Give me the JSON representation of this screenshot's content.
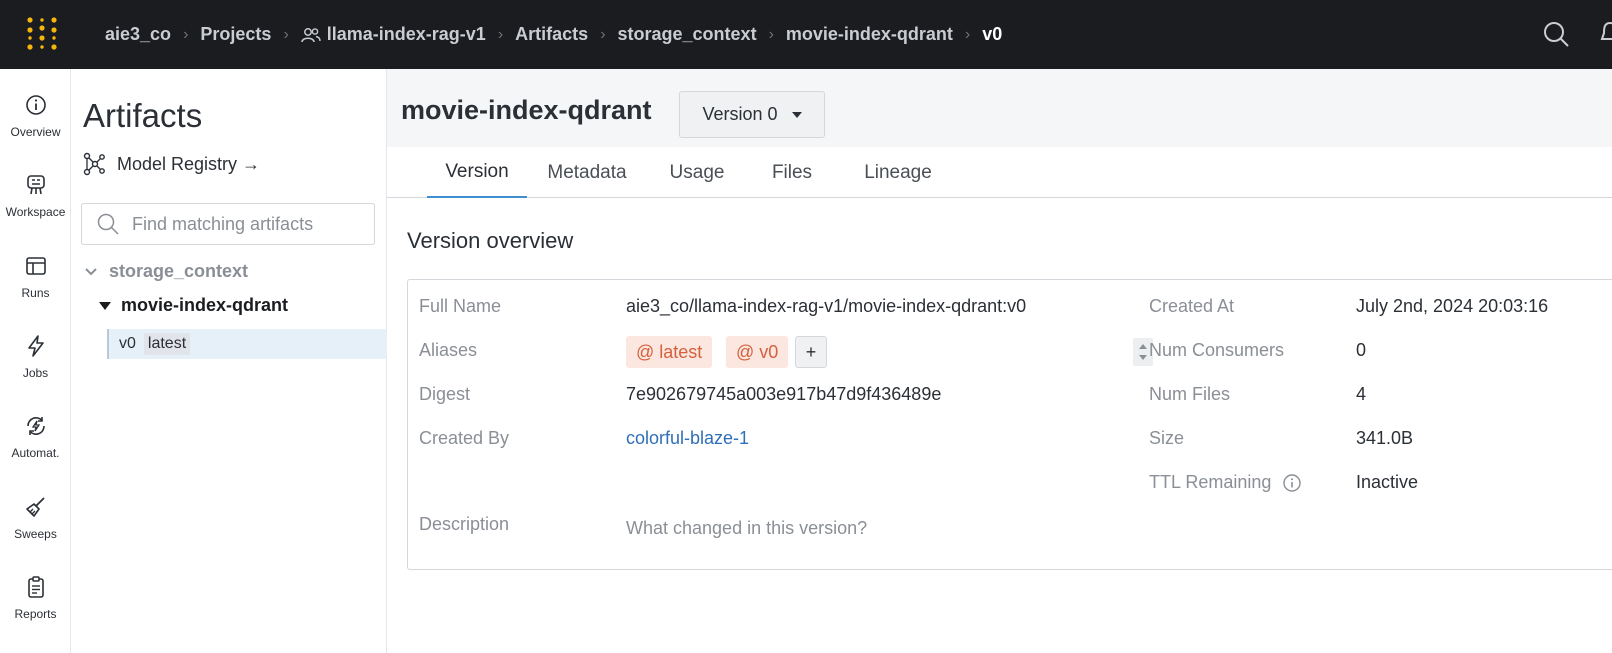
{
  "breadcrumb": {
    "entity": "aie3_co",
    "projects": "Projects",
    "project": "llama-index-rag-v1",
    "artifacts": "Artifacts",
    "type": "storage_context",
    "collection": "movie-index-qdrant",
    "version": "v0"
  },
  "rail": [
    {
      "label": "Overview",
      "icon": "info-icon"
    },
    {
      "label": "Workspace",
      "icon": "workspace-icon"
    },
    {
      "label": "Runs",
      "icon": "table-icon"
    },
    {
      "label": "Jobs",
      "icon": "lightning-icon"
    },
    {
      "label": "Automat.",
      "icon": "automation-icon"
    },
    {
      "label": "Sweeps",
      "icon": "broom-icon"
    },
    {
      "label": "Reports",
      "icon": "clipboard-icon"
    }
  ],
  "artifacts_panel": {
    "title": "Artifacts",
    "model_registry": "Model Registry →",
    "search_placeholder": "Find matching artifacts",
    "tree": {
      "type": "storage_context",
      "collection": "movie-index-qdrant",
      "version": "v0",
      "version_tag": "latest"
    }
  },
  "main": {
    "title": "movie-index-qdrant",
    "version_select": "Version 0",
    "tabs": [
      "Version",
      "Metadata",
      "Usage",
      "Files",
      "Lineage"
    ],
    "active_tab": "Version",
    "overview_title": "Version overview",
    "fields": {
      "full_name_label": "Full Name",
      "full_name": "aie3_co/llama-index-rag-v1/movie-index-qdrant:v0",
      "aliases_label": "Aliases",
      "aliases": [
        "@ latest",
        "@ v0"
      ],
      "alias_add": "+",
      "digest_label": "Digest",
      "digest": "7e902679745a003e917b47d9f436489e",
      "created_by_label": "Created By",
      "created_by": "colorful-blaze-1",
      "description_label": "Description",
      "description_placeholder": "What changed in this version?",
      "created_at_label": "Created At",
      "created_at": "July 2nd, 2024 20:03:16",
      "num_consumers_label": "Num Consumers",
      "num_consumers": "0",
      "num_files_label": "Num Files",
      "num_files": "4",
      "size_label": "Size",
      "size": "341.0B",
      "ttl_label": "TTL Remaining",
      "ttl": "Inactive"
    }
  },
  "colors": {
    "topbar": "#1a1c1f",
    "logo_yellow": "#f5b50a",
    "tab_accent": "#3f8ed0",
    "alias_bg": "#fbe6e0",
    "alias_text": "#d4613b",
    "link": "#2f6fb8"
  }
}
